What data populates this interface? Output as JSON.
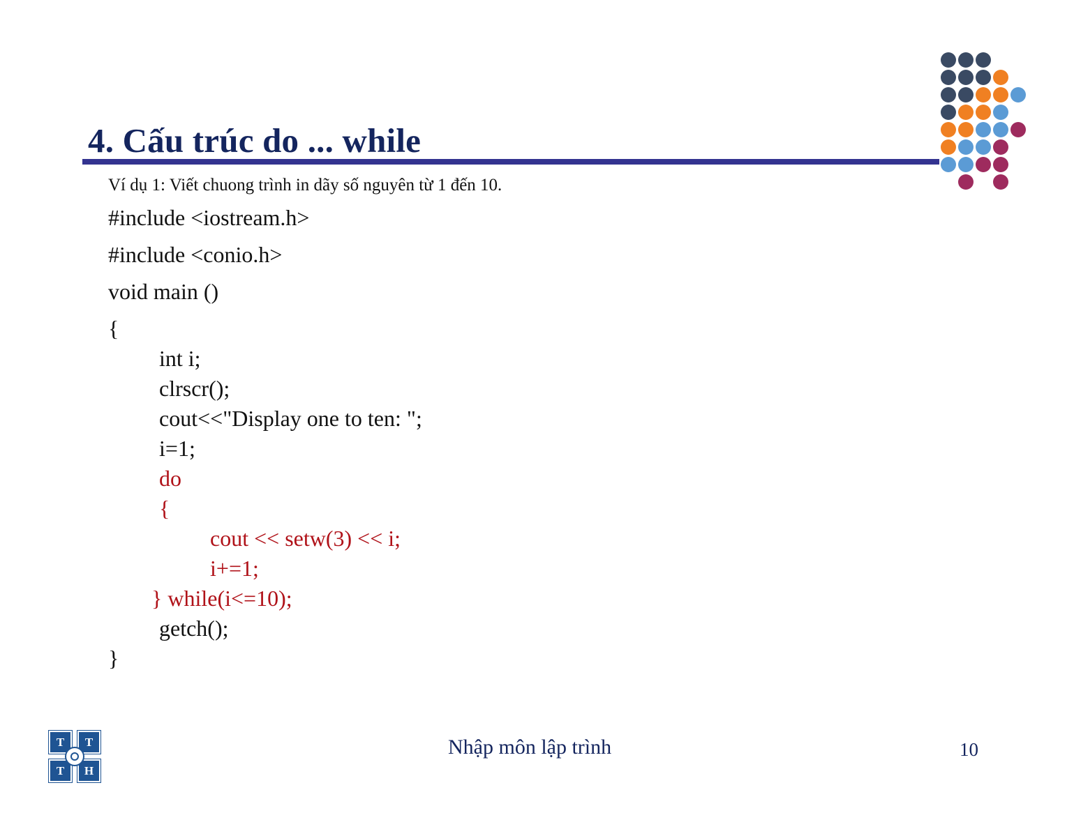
{
  "slide": {
    "title": "4. Cấu trúc do ... while",
    "example_intro": "Ví dụ 1: Viết chuong trình in dãy số nguyên từ 1 đến 10.",
    "page_number": "10",
    "footer": "Nhập môn lập trình"
  },
  "code": {
    "lines": [
      {
        "text": "#include <iostream.h>",
        "indent": 0,
        "color": "black",
        "spacing": "loose"
      },
      {
        "text": "#include <conio.h>",
        "indent": 0,
        "color": "black",
        "spacing": "loose"
      },
      {
        "text": "void main ()",
        "indent": 0,
        "color": "black",
        "spacing": "loose"
      },
      {
        "text": "{",
        "indent": 0,
        "color": "black",
        "spacing": "tight"
      },
      {
        "text": "int i;",
        "indent": 1,
        "color": "black",
        "spacing": "tight"
      },
      {
        "text": "clrscr();",
        "indent": 1,
        "color": "black",
        "spacing": "tight"
      },
      {
        "text": "cout<<\"Display one to ten: \";",
        "indent": 1,
        "color": "black",
        "spacing": "tight"
      },
      {
        "text": "i=1;",
        "indent": 1,
        "color": "black",
        "spacing": "tight"
      },
      {
        "text": "do",
        "indent": 1,
        "color": "red",
        "spacing": "tight"
      },
      {
        "text": "{",
        "indent": 1,
        "color": "red",
        "spacing": "tight"
      },
      {
        "text": "cout << setw(3) << i;",
        "indent": 2,
        "color": "red",
        "spacing": "tight"
      },
      {
        "text": "i+=1;",
        "indent": 2,
        "color": "red",
        "spacing": "tight"
      },
      {
        "text": "} while(i<=10);",
        "indent": "w",
        "color": "red",
        "spacing": "tight"
      },
      {
        "text": "getch();",
        "indent": 1,
        "color": "black",
        "spacing": "tight"
      },
      {
        "text": "}",
        "indent": 0,
        "color": "black",
        "spacing": "tight"
      }
    ]
  },
  "logo": {
    "name": "tth-logo",
    "letters": [
      "T",
      "T",
      "T",
      "H"
    ]
  },
  "colors": {
    "title_navy": "#14255E",
    "rule_blue": "#333390",
    "code_red": "#B01219",
    "code_black": "#111111",
    "logo_blue": "#1F5493",
    "dot_navy": "#3A4A63",
    "dot_orange": "#F08022",
    "dot_blue": "#5B9BD5",
    "dot_maroon": "#9E2B5E"
  },
  "decoration": {
    "name": "dot-grid",
    "cell": 25,
    "grid": [
      [
        "navy",
        "navy",
        "navy",
        null,
        null
      ],
      [
        "navy",
        "navy",
        "navy",
        "orange",
        null
      ],
      [
        "navy",
        "navy",
        "orange",
        "orange",
        "blue"
      ],
      [
        "navy",
        "orange",
        "orange",
        "blue",
        null
      ],
      [
        "orange",
        "orange",
        "blue",
        "blue",
        "maroon"
      ],
      [
        "orange",
        "blue",
        "blue",
        "maroon",
        null
      ],
      [
        "blue",
        "blue",
        "maroon",
        "maroon",
        null
      ],
      [
        null,
        "maroon",
        null,
        "maroon",
        null
      ]
    ]
  }
}
